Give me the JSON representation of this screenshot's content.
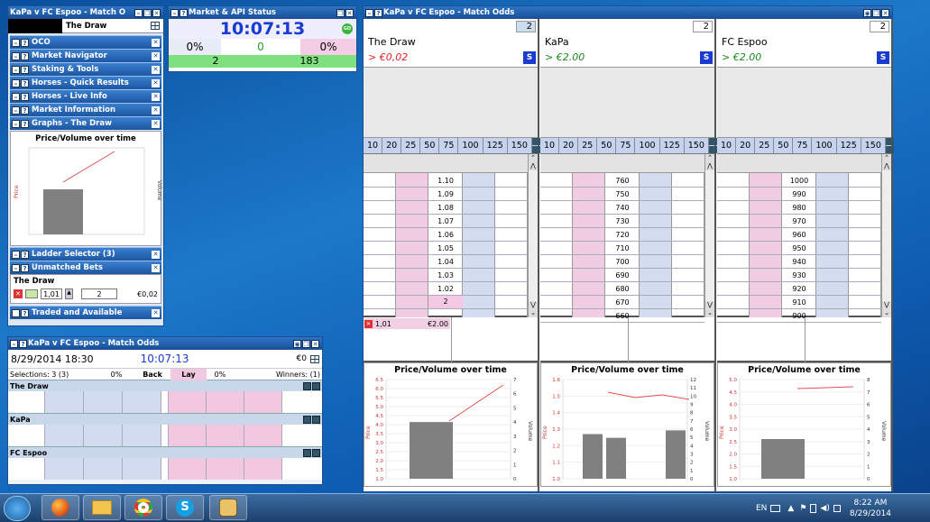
{
  "left_panel": {
    "title": "KaPa v FC Espoo - Match O",
    "selection": "The Draw",
    "sections": [
      "OCO",
      "Market Navigator",
      "Staking & Tools",
      "Horses - Quick Results",
      "Horses - Live Info",
      "Market Information",
      "Graphs - The Draw"
    ],
    "chart_title": "Price/Volume over time",
    "chart_ylabel": "Price",
    "chart_y2label": "Volume",
    "sections2": [
      "Ladder Selector (3)",
      "Unmatched Bets"
    ],
    "unmatched_runner": "The Draw",
    "unmatched_odds": "1,01",
    "unmatched_stake": "2",
    "unmatched_amount": "€0,02",
    "traded": "Traded and Available"
  },
  "status_panel": {
    "title": "Market & API Status",
    "clock": "10:07:13",
    "go": "GO",
    "back_pct": "0%",
    "mid_val": "0",
    "lay_pct": "0%",
    "left_count": "2",
    "right_count": "183"
  },
  "mini_panel": {
    "title": "KaPa v FC Espoo - Match Odds",
    "date": "8/29/2014  18:30",
    "clock": "10:07:13",
    "balance": "€0",
    "selections": "Selections: 3 (3)",
    "back_pct": "0%",
    "back_label": "Back",
    "lay_label": "Lay",
    "lay_pct": "0%",
    "winners": "Winners: (1)",
    "runners": [
      "The Draw",
      "KaPa",
      "FC Espoo"
    ]
  },
  "ladder_window": {
    "title": "KaPa v FC Espoo - Match Odds",
    "stake_buttons": [
      "10",
      "20",
      "25",
      "50",
      "75",
      "100",
      "125",
      "150"
    ],
    "columns": [
      {
        "name": "The Draw",
        "count": "2",
        "price": "> €0,02",
        "prices": [
          "1.10",
          "1.09",
          "1.08",
          "1.07",
          "1.06",
          "1.05",
          "1.04",
          "1.03",
          "1.02",
          ""
        ],
        "lay_highlight": "2",
        "order_odds": "1,01",
        "order_amount": "€2.00",
        "chart": {
          "title": "Price/Volume over time",
          "ylabel": "Price",
          "y2label": "Volume",
          "yticks": [
            "6.5",
            "6.0",
            "5.5",
            "5.0",
            "4.5",
            "4.0",
            "3.5",
            "3.0",
            "2.5",
            "2.0",
            "1.5",
            "1.0"
          ],
          "y2ticks": [
            "7",
            "6",
            "5",
            "4",
            "3",
            "2",
            "1",
            "0"
          ]
        }
      },
      {
        "name": "KaPa",
        "count": "2",
        "price": "> €2.00",
        "prices": [
          "760",
          "750",
          "740",
          "730",
          "720",
          "710",
          "700",
          "690",
          "680",
          "670",
          "660"
        ],
        "chart": {
          "title": "Price/Volume over time",
          "ylabel": "Price",
          "y2label": "Volume",
          "yticks": [
            "1.6",
            "1.5",
            "1.4",
            "1.3",
            "1.2",
            "1.1",
            "1.0"
          ],
          "y2ticks": [
            "12",
            "11",
            "10",
            "9",
            "8",
            "7",
            "6",
            "5",
            "4",
            "3",
            "2",
            "1",
            "0"
          ]
        }
      },
      {
        "name": "FC Espoo",
        "count": "2",
        "price": "> €2.00",
        "prices": [
          "1000",
          "990",
          "980",
          "970",
          "960",
          "950",
          "940",
          "930",
          "920",
          "910",
          "900"
        ],
        "chart": {
          "title": "Price/Volume over time",
          "ylabel": "Price",
          "y2label": "Volume",
          "yticks": [
            "5.0",
            "4.5",
            "4.0",
            "3.5",
            "3.0",
            "2.5",
            "2.0",
            "1.5",
            "1.0"
          ],
          "y2ticks": [
            "8",
            "7",
            "6",
            "5",
            "4",
            "3",
            "2",
            "1",
            "0"
          ]
        }
      }
    ]
  },
  "taskbar": {
    "lang": "EN",
    "time": "8:22 AM",
    "date": "8/29/2014"
  }
}
